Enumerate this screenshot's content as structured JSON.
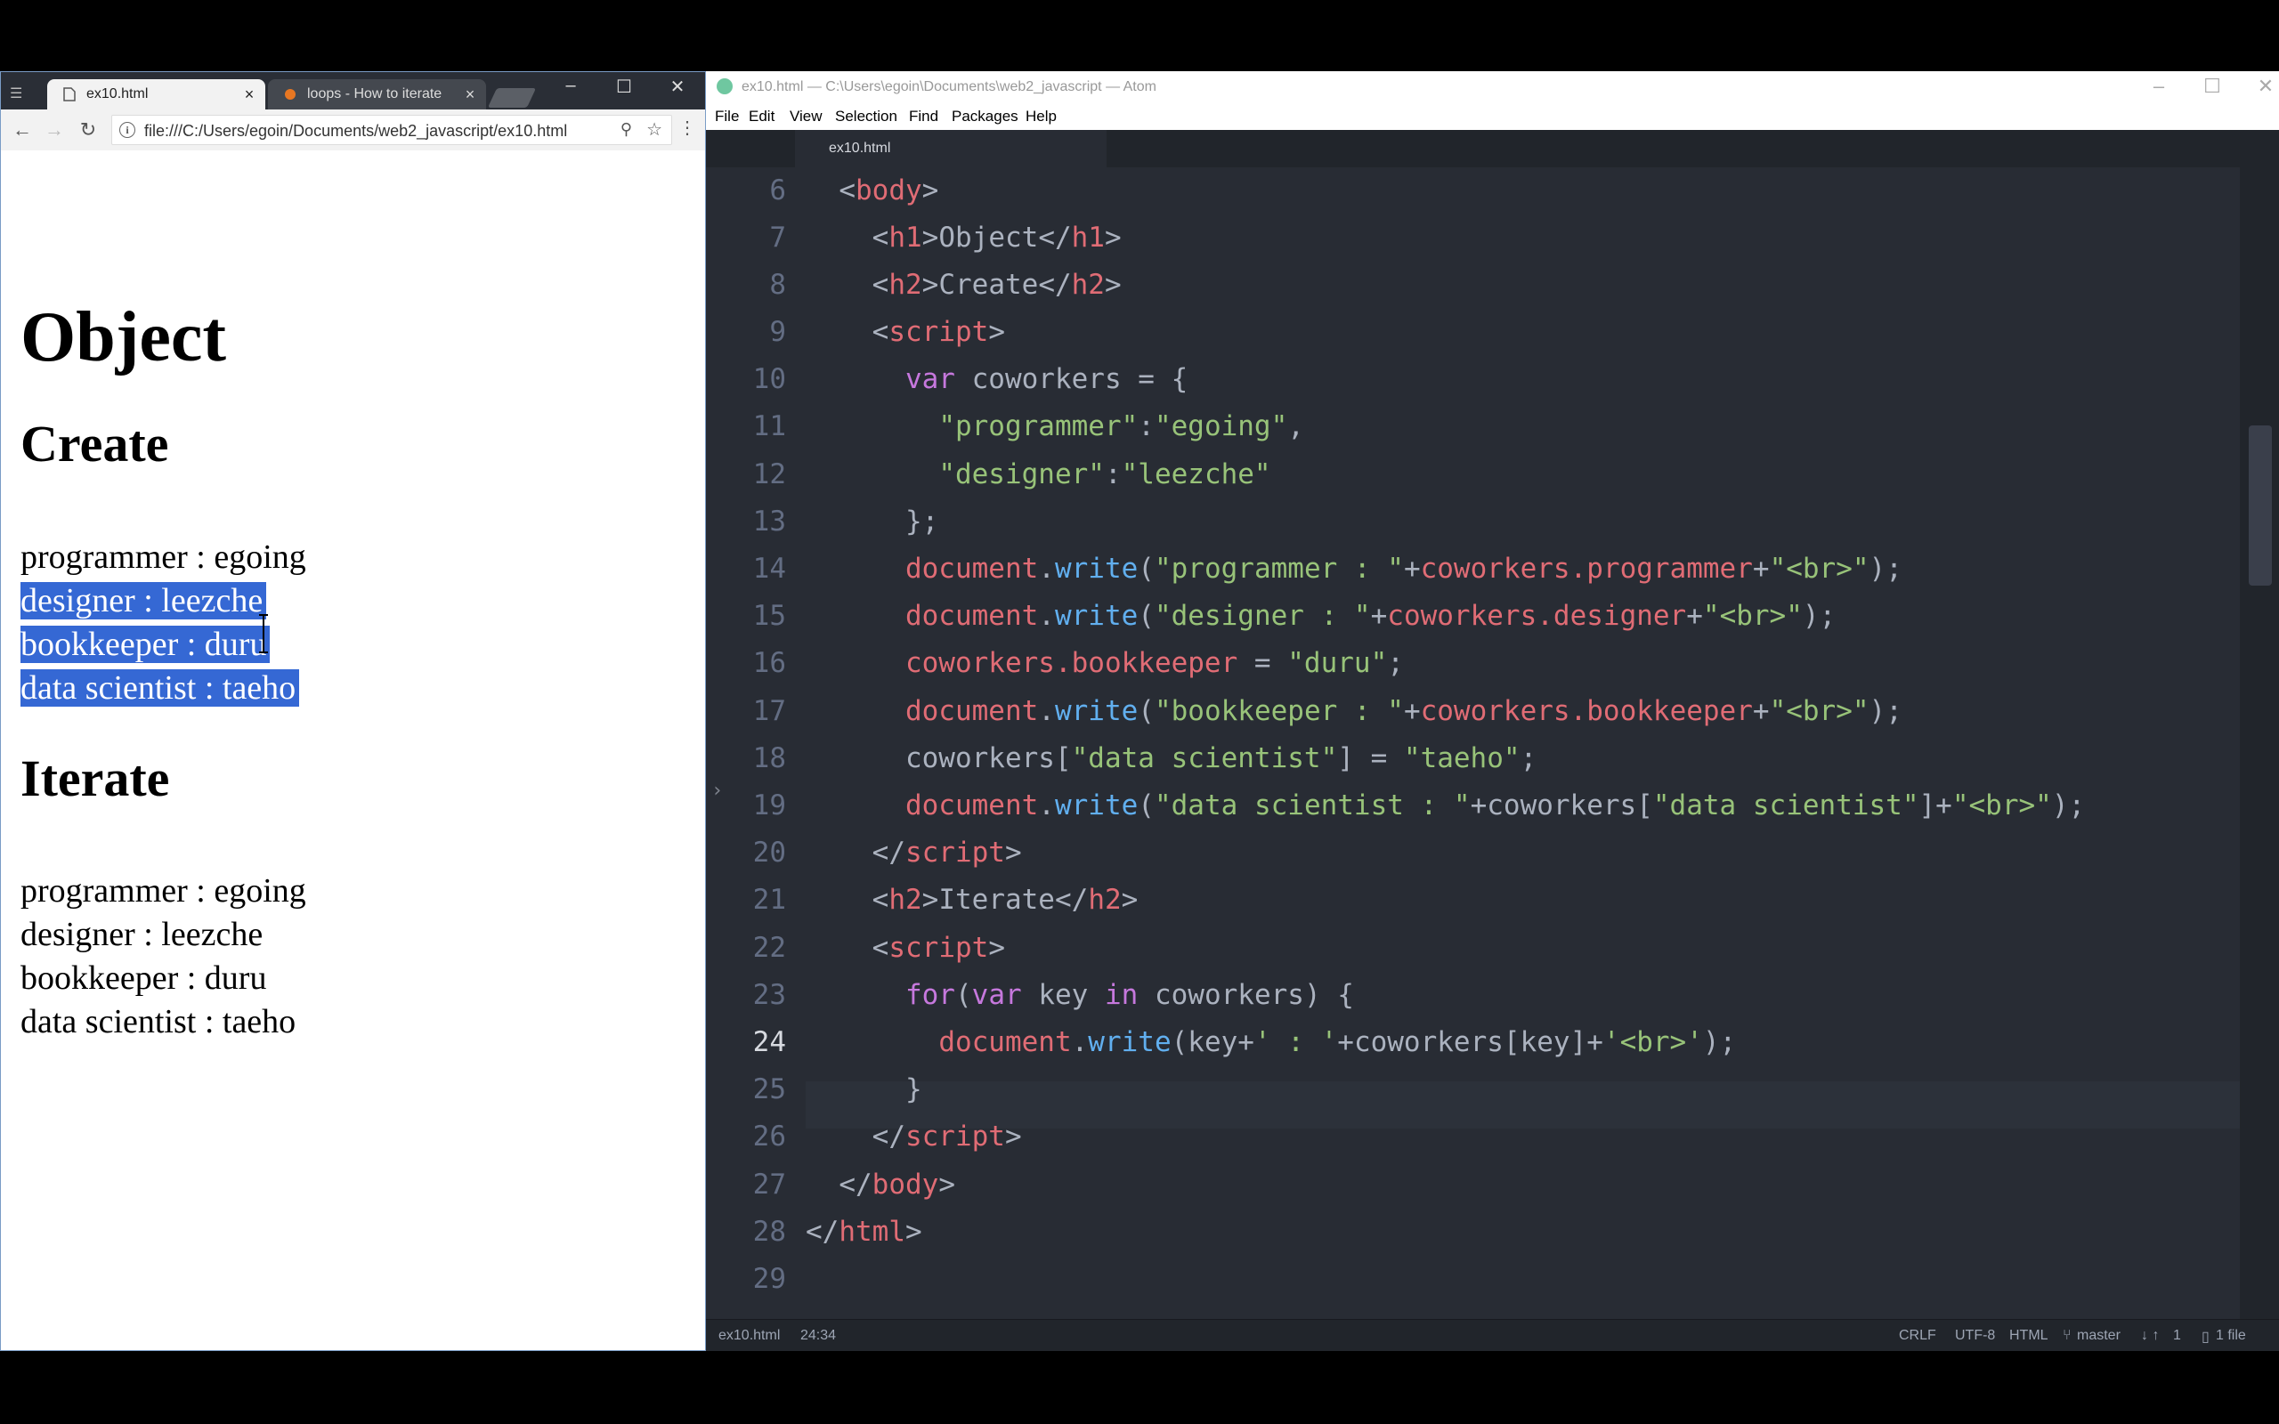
{
  "browser": {
    "tabs": [
      {
        "label": "ex10.html",
        "active": true
      },
      {
        "label": "loops - How to iterate",
        "active": false
      }
    ],
    "url": "file:///C:/Users/egoin/Documents/web2_javascript/ex10.html",
    "page": {
      "h1": "Object",
      "create_heading": "Create",
      "create_lines": [
        "programmer : egoing",
        "designer : leezche",
        "bookkeeper : duru",
        "data scientist : taeho"
      ],
      "iterate_heading": "Iterate",
      "iterate_lines": [
        "programmer : egoing",
        "designer : leezche",
        "bookkeeper : duru",
        "data scientist : taeho"
      ]
    }
  },
  "atom": {
    "title": "ex10.html — C:\\Users\\egoin\\Documents\\web2_javascript — Atom",
    "menu": [
      "File",
      "Edit",
      "View",
      "Selection",
      "Find",
      "Packages",
      "Help"
    ],
    "file_tab": "ex10.html",
    "line_numbers": [
      "6",
      "7",
      "8",
      "9",
      "10",
      "11",
      "12",
      "13",
      "14",
      "15",
      "16",
      "17",
      "18",
      "19",
      "20",
      "21",
      "22",
      "23",
      "24",
      "25",
      "26",
      "27",
      "28",
      "29"
    ],
    "current_line": "24",
    "code": {
      "l6_body_open": "body",
      "l7_h1_open": "h1",
      "l7_text": "Object",
      "l7_h1_close": "h1",
      "l8_h2_open": "h2",
      "l8_text": "Create",
      "l8_h2_close": "h2",
      "l9_script": "script",
      "l10_var": "var",
      "l10_name": " coworkers = {",
      "l11_key": "\"programmer\"",
      "l11_val": "\"egoing\"",
      "l12_key": "\"designer\"",
      "l12_val": "\"leezche\"",
      "l13": "};",
      "doc": "document",
      "write": "write",
      "l14_str1": "\"programmer : \"",
      "l14_ref": "coworkers.programmer",
      "l14_str2": "\"<br>\"",
      "l15_str1": "\"designer : \"",
      "l15_ref": "coworkers.designer",
      "l16_ref": "coworkers.bookkeeper",
      "l16_str": "\"duru\"",
      "l17_str1": "\"bookkeeper : \"",
      "l17_ref": "coworkers.bookkeeper",
      "l18_obj": "coworkers[",
      "l18_key": "\"data scientist\"",
      "l18_mid": "] = ",
      "l18_val": "\"taeho\"",
      "l19_str1": "\"data scientist : \"",
      "l19_ref": "+coworkers[",
      "l19_key": "\"data scientist\"",
      "script_close": "script",
      "l21_h2": "h2",
      "l21_text": "Iterate",
      "l23_for": "for",
      "l23_var": "var",
      "l23_key": " key ",
      "l23_in": "in",
      "l23_rest": " coworkers) {",
      "l24_key": "key+",
      "l24_str1": "' : '",
      "l24_ref": "+coworkers[key]+",
      "l24_str2": "'<br>'",
      "l25": "}",
      "l27_body": "body",
      "l28_html": "html"
    },
    "status": {
      "file": "ex10.html",
      "cursor": "24:34",
      "line_ending": "CRLF",
      "encoding": "UTF-8",
      "grammar": "HTML",
      "branch": "master",
      "sync": "1",
      "files": "1 file"
    }
  }
}
